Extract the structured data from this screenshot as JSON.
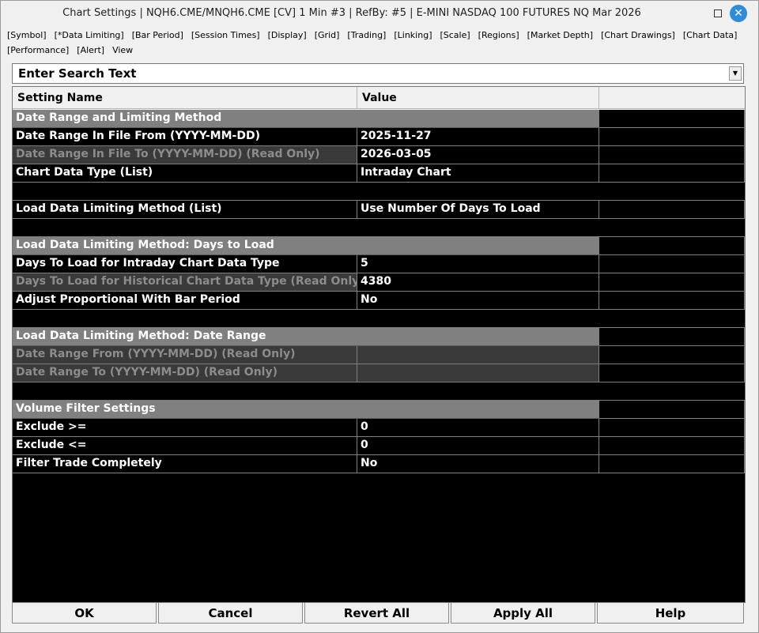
{
  "window": {
    "title": "Chart Settings | NQH6.CME/MNQH6.CME [CV]  1 Min  #3 | RefBy: #5 | E-MINI NASDAQ 100 FUTURES NQ Mar 2026",
    "close_glyph": "✕"
  },
  "tabs": [
    "[Symbol]",
    "[*Data Limiting]",
    "[Bar Period]",
    "[Session Times]",
    "[Display]",
    "[Grid]",
    "[Trading]",
    "[Linking]",
    "[Scale]",
    "[Regions]",
    "[Market Depth]",
    "[Chart Drawings]",
    "[Chart Data]",
    "[Performance]",
    "[Alert]",
    "View"
  ],
  "search": {
    "value": "Enter Search Text",
    "arrow": "▼"
  },
  "grid": {
    "headers": {
      "name": "Setting Name",
      "value": "Value"
    },
    "rows": [
      {
        "type": "section",
        "name": "Date Range and Limiting Method"
      },
      {
        "type": "setting",
        "name": "Date Range In File From (YYYY-MM-DD)",
        "value": "2025-11-27"
      },
      {
        "type": "readonly",
        "name": "Date Range In File To (YYYY-MM-DD) (Read Only)",
        "value": "2026-03-05"
      },
      {
        "type": "setting",
        "name": "Chart Data Type (List)",
        "value": "Intraday Chart"
      },
      {
        "type": "blank"
      },
      {
        "type": "setting",
        "name": "Load Data Limiting Method (List)",
        "value": "Use Number Of Days To Load"
      },
      {
        "type": "blank"
      },
      {
        "type": "section",
        "name": "Load Data Limiting Method: Days to Load"
      },
      {
        "type": "setting",
        "name": "Days To Load for Intraday Chart Data Type",
        "value": "5"
      },
      {
        "type": "readonly",
        "name": "Days To Load for Historical Chart Data Type (Read Only)",
        "value": "4380"
      },
      {
        "type": "setting",
        "name": "Adjust Proportional With Bar Period",
        "value": "No"
      },
      {
        "type": "blank"
      },
      {
        "type": "section",
        "name": "Load Data Limiting Method: Date Range"
      },
      {
        "type": "readonly-both",
        "name": "Date Range From (YYYY-MM-DD) (Read Only)",
        "value": ""
      },
      {
        "type": "readonly-both",
        "name": "Date Range To (YYYY-MM-DD) (Read Only)",
        "value": ""
      },
      {
        "type": "blank"
      },
      {
        "type": "section",
        "name": "Volume Filter Settings"
      },
      {
        "type": "setting",
        "name": "Exclude >=",
        "value": "0"
      },
      {
        "type": "setting",
        "name": "Exclude <=",
        "value": "0"
      },
      {
        "type": "setting",
        "name": "Filter Trade Completely",
        "value": "No"
      }
    ]
  },
  "footer": {
    "ok": "OK",
    "cancel": "Cancel",
    "revert_all": "Revert All",
    "apply_all": "Apply All",
    "help": "Help"
  }
}
